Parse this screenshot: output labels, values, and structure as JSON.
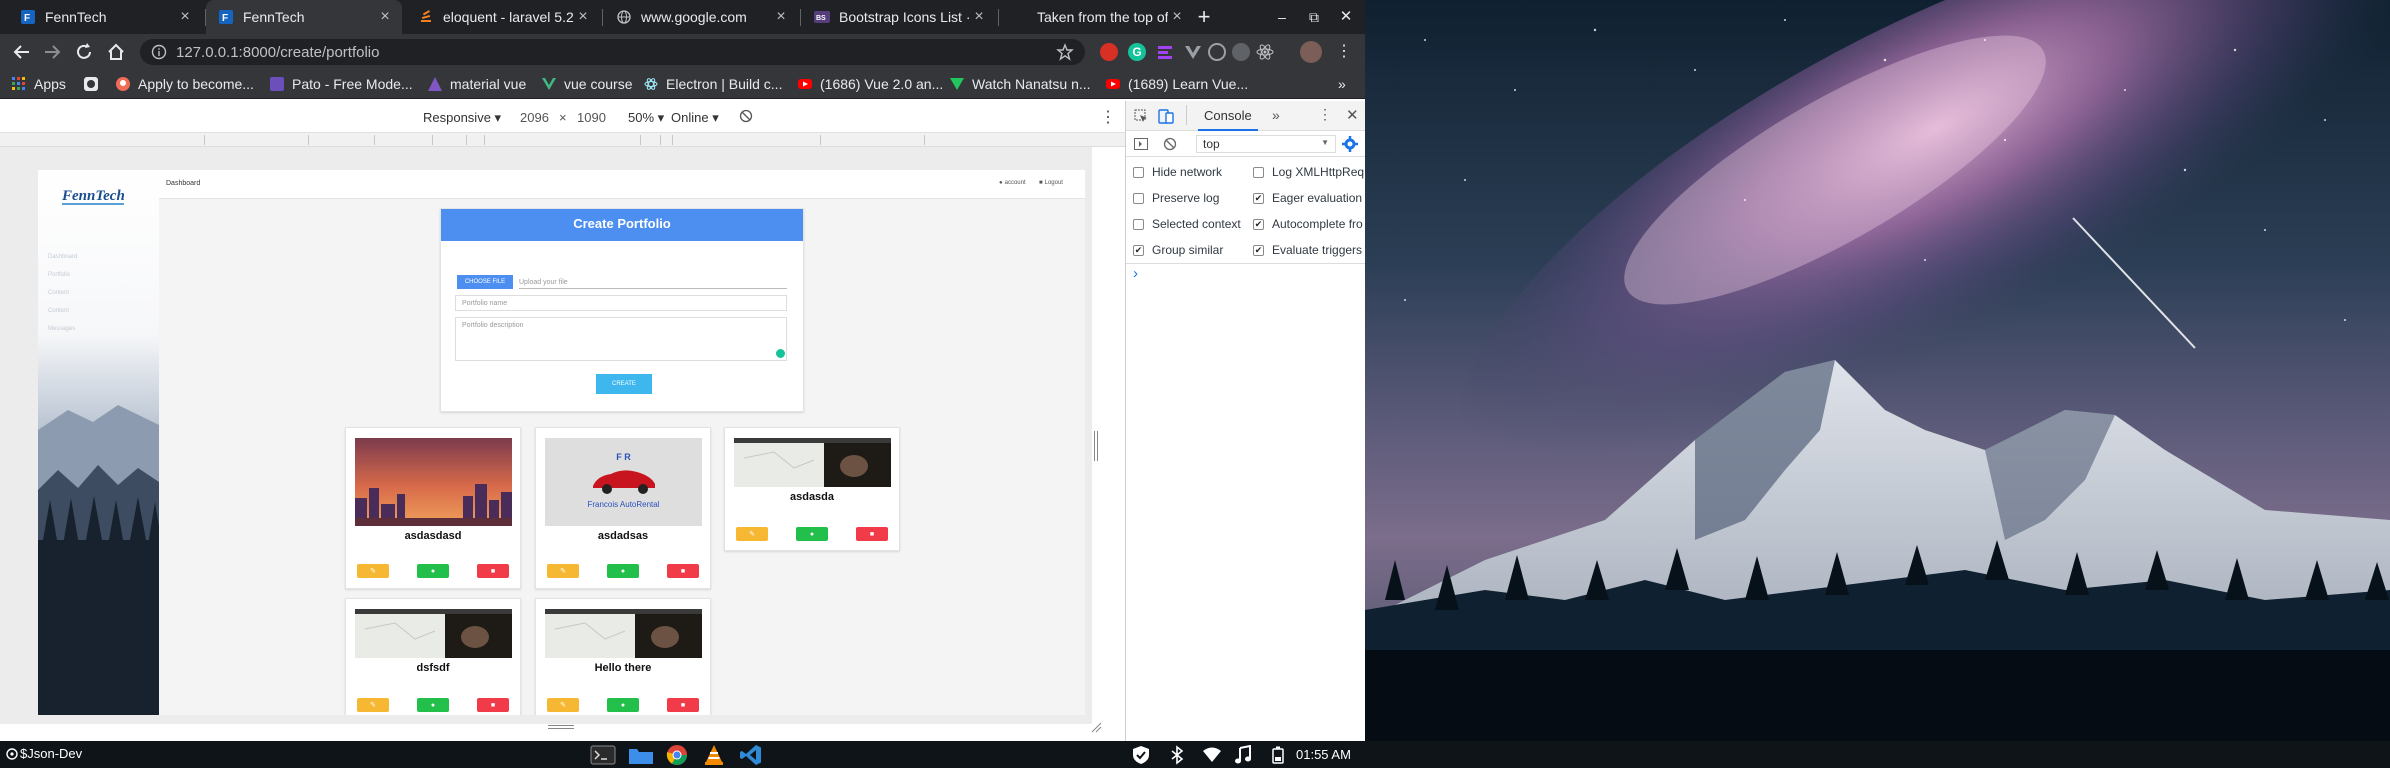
{
  "browser": {
    "tabs": [
      {
        "title": "FennTech",
        "icon": "fenntech-favicon"
      },
      {
        "title": "FennTech",
        "icon": "fenntech-favicon",
        "active": true
      },
      {
        "title": "eloquent - laravel 5.2",
        "icon": "stackoverflow-icon"
      },
      {
        "title": "www.google.com",
        "icon": "globe-icon"
      },
      {
        "title": "Bootstrap Icons List ·",
        "icon": "bootstrap-icon"
      },
      {
        "title": "Taken from the top of",
        "icon": "blank-icon"
      }
    ],
    "new_tab_label": "+",
    "window_controls": {
      "minimize": "‒",
      "maximize": "⧉",
      "close": "✕"
    },
    "url": "127.0.0.1:8000/create/portfolio",
    "bookmarks": [
      {
        "label": "Apps",
        "icon": "apps-grid-icon"
      },
      {
        "label": "",
        "icon": "pocket-icon"
      },
      {
        "label": "Apply to become...",
        "icon": "avatar-icon"
      },
      {
        "label": "Pato - Free Mode...",
        "icon": "pato-icon"
      },
      {
        "label": "material vue",
        "icon": "material-icon"
      },
      {
        "label": "vue course",
        "icon": "vue-icon"
      },
      {
        "label": "Electron | Build c...",
        "icon": "electron-icon"
      },
      {
        "label": "(1686) Vue 2.0 an...",
        "icon": "youtube-icon"
      },
      {
        "label": "Watch Nanatsu n...",
        "icon": "green-v-icon"
      },
      {
        "label": "(1689) Learn Vue...",
        "icon": "youtube-icon"
      }
    ],
    "more_bookmarks": "»"
  },
  "device_toolbar": {
    "device": "Responsive ▾",
    "width": "2096",
    "times": "×",
    "height": "1090",
    "zoom": "50% ▾",
    "network": "Online ▾"
  },
  "app": {
    "logo": "FennTech",
    "sidebar_items": [
      "Dashboard",
      "Portfolio",
      "Content",
      "Content",
      "Messages"
    ],
    "breadcrumb": "Dashboard",
    "account_label": "account",
    "logout_label": "Logout",
    "form": {
      "title": "Create Portfolio",
      "choose_file": "CHOOSE FILE",
      "file_placeholder": "Upload your file",
      "name_placeholder": "Portfolio name",
      "description_placeholder": "Portfolio description",
      "submit": "CREATE"
    },
    "portfolios": [
      {
        "name": "asdasdasd",
        "thumb": "sunset-city"
      },
      {
        "name": "asdadsas",
        "thumb": "car-rental-logo",
        "logo_top": "F  R",
        "logo_bottom": "Francois AutoRental"
      },
      {
        "name": "asdasda",
        "thumb": "map-cat"
      },
      {
        "name": "dsfsdf",
        "thumb": "map-cat"
      },
      {
        "name": "Hello there",
        "thumb": "map-cat"
      }
    ]
  },
  "devtools": {
    "tab_console": "Console",
    "more_tabs": "»",
    "context": "top",
    "options_left": [
      {
        "label": "Hide network",
        "checked": false
      },
      {
        "label": "Preserve log",
        "checked": false
      },
      {
        "label": "Selected context",
        "checked": false
      },
      {
        "label": "Group similar",
        "checked": true
      }
    ],
    "options_right": [
      {
        "label": "Log XMLHttpReq",
        "checked": false
      },
      {
        "label": "Eager evaluation",
        "checked": true
      },
      {
        "label": "Autocomplete fro",
        "checked": true
      },
      {
        "label": "Evaluate triggers",
        "checked": true
      }
    ],
    "prompt": "›"
  },
  "taskbar": {
    "launcher": "$Json-Dev",
    "clock": "01:55 AM"
  }
}
